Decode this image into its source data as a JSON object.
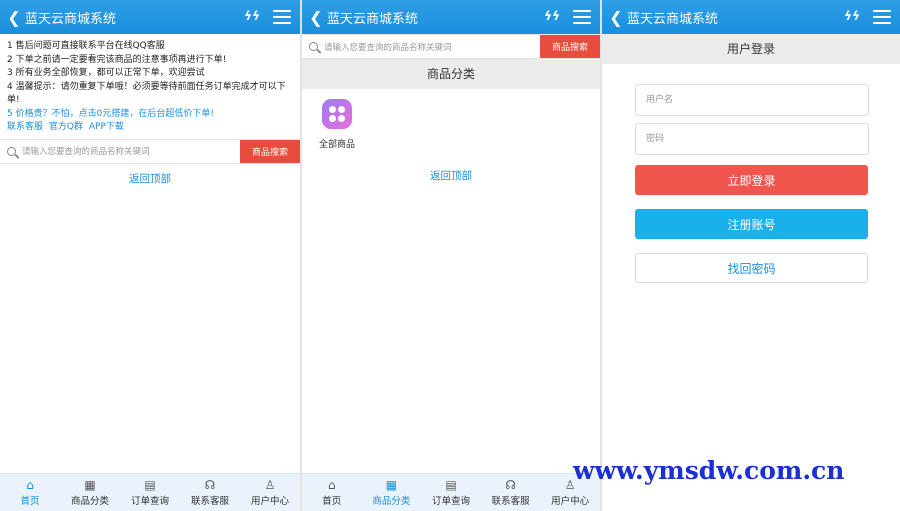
{
  "app_title": "蓝天云商城系统",
  "header": {
    "back_icon": "chevron-left-icon",
    "refresh_icon": "refresh-icon",
    "menu_icon": "menu-icon"
  },
  "notice": {
    "lines": [
      "1 售后问题可直接联系平台在线QQ客服",
      "2 下单之前请一定要看完该商品的注意事项再进行下单!",
      "3 所有业务全部恢复，都可以正常下单，欢迎尝试",
      "4 温馨提示：请勿重复下单哦！必须要等待前面任务订单完成才可以下单!"
    ],
    "promo": "5 价格贵？不怕，点击0元搭建，在后台超低价下单!",
    "links": [
      "联系客服",
      "官方Q群",
      "APP下载"
    ]
  },
  "search": {
    "placeholder": "请输入您要查询的商品名称关键词",
    "button": "商品搜索"
  },
  "back_to_top": "返回顶部",
  "category": {
    "title": "商品分类",
    "item_label": "全部商品"
  },
  "login": {
    "title": "用户登录",
    "username_placeholder": "用户名",
    "password_placeholder": "密码",
    "login_button": "立即登录",
    "register_button": "注册账号",
    "recover_button": "找回密码"
  },
  "tabs": [
    {
      "label": "首页",
      "icon": "home-icon"
    },
    {
      "label": "商品分类",
      "icon": "grid-icon"
    },
    {
      "label": "订单查询",
      "icon": "clipboard-icon"
    },
    {
      "label": "联系客服",
      "icon": "headset-icon"
    },
    {
      "label": "用户中心",
      "icon": "user-icon"
    }
  ],
  "watermark": "www.ymsdw.com.cn",
  "colors": {
    "header": "#1b8fdd",
    "search_button": "#e74c3c",
    "login_button": "#f0564d",
    "register_button": "#1ab0ea",
    "link": "#1a8ee0"
  }
}
